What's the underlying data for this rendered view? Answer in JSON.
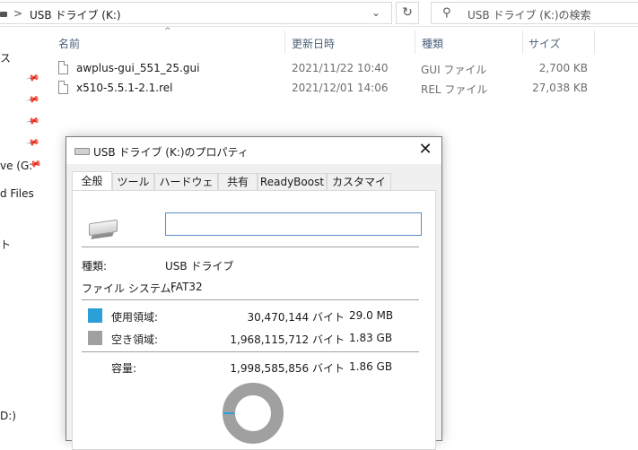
{
  "address": {
    "separator": ">",
    "path": "USB ドライブ (K:)",
    "dropdown_icon": "chevron-down-icon",
    "refresh_icon": "refresh-icon"
  },
  "search": {
    "placeholder": "USB ドライブ (K:)の検索",
    "icon": "search-icon"
  },
  "nav": {
    "items": [
      {
        "label": "ス"
      },
      {
        "label": "ve (G:"
      },
      {
        "label": "d Files"
      },
      {
        "label": "ト"
      },
      {
        "label": "D:)"
      }
    ]
  },
  "columns": {
    "name": "名前",
    "date": "更新日時",
    "type": "種類",
    "size": "サイズ"
  },
  "files": [
    {
      "name": "awplus-gui_551_25.gui",
      "date": "2021/11/22 10:40",
      "type": "GUI ファイル",
      "size": "2,700 KB"
    },
    {
      "name": "x510-5.5.1-2.1.rel",
      "date": "2021/12/01 14:06",
      "type": "REL ファイル",
      "size": "27,038 KB"
    }
  ],
  "dialog": {
    "title": "USB ドライブ (K:)のプロパティ",
    "close_glyph": "✕",
    "tabs": [
      "全般",
      "ツール",
      "ハードウェア",
      "共有",
      "ReadyBoost",
      "カスタマイズ"
    ],
    "active_tab": "全般",
    "volume_name": "",
    "type_label": "種類:",
    "type_value": "USB ドライブ",
    "fs_label": "ファイル システム:",
    "fs_value": "FAT32",
    "used_label": "使用領域:",
    "used_bytes": "30,470,144 バイト",
    "used_size": "29.0 MB",
    "free_label": "空き領域:",
    "free_bytes": "1,968,115,712 バイト",
    "free_size": "1.83 GB",
    "capacity_label": "容量:",
    "capacity_bytes": "1,998,585,856 バイト",
    "capacity_size": "1.86 GB",
    "used_color": "#2ba0d8",
    "free_color": "#a0a0a0"
  }
}
